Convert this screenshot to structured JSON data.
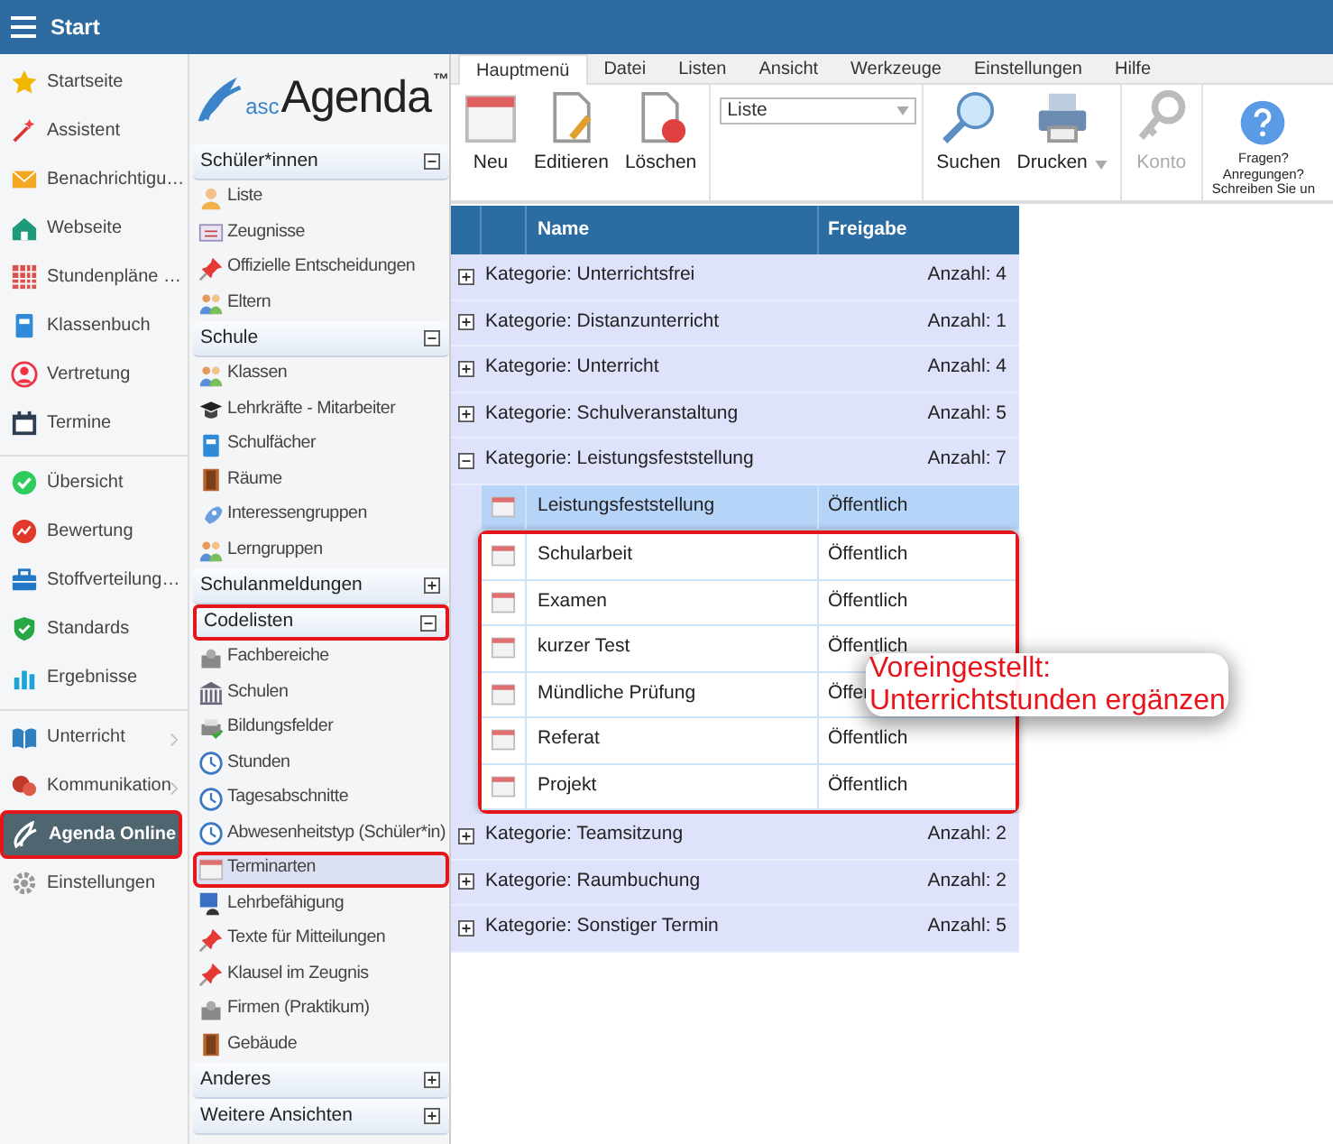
{
  "app_bar": {
    "title": "Start"
  },
  "sidebar": {
    "groups": [
      [
        {
          "label": "Startseite",
          "selected": false,
          "outlined": false,
          "submenu": false
        },
        {
          "label": "Assistent",
          "selected": false,
          "outlined": false,
          "submenu": false
        },
        {
          "label": "Benachrichtigu…",
          "selected": false,
          "outlined": false,
          "submenu": false
        },
        {
          "label": "Webseite",
          "selected": false,
          "outlined": false,
          "submenu": false
        },
        {
          "label": "Stundenpläne …",
          "selected": false,
          "outlined": false,
          "submenu": false
        },
        {
          "label": "Klassenbuch",
          "selected": false,
          "outlined": false,
          "submenu": false
        },
        {
          "label": "Vertretung",
          "selected": false,
          "outlined": false,
          "submenu": false
        },
        {
          "label": "Termine",
          "selected": false,
          "outlined": false,
          "submenu": false
        }
      ],
      [
        {
          "label": "Übersicht",
          "selected": false,
          "outlined": false,
          "submenu": false
        },
        {
          "label": "Bewertung",
          "selected": false,
          "outlined": false,
          "submenu": false
        },
        {
          "label": "Stoffverteilung…",
          "selected": false,
          "outlined": false,
          "submenu": false
        },
        {
          "label": "Standards",
          "selected": false,
          "outlined": false,
          "submenu": false
        },
        {
          "label": "Ergebnisse",
          "selected": false,
          "outlined": false,
          "submenu": false
        }
      ],
      [
        {
          "label": "Unterricht",
          "selected": false,
          "outlined": false,
          "submenu": true
        },
        {
          "label": "Kommunikation",
          "selected": false,
          "outlined": false,
          "submenu": true
        },
        {
          "label": "Agenda Online",
          "selected": true,
          "outlined": true,
          "submenu": false
        },
        {
          "label": "Einstellungen",
          "selected": false,
          "outlined": false,
          "submenu": false
        }
      ]
    ]
  },
  "module_panel": {
    "logo": {
      "prefix": "asc",
      "name": "Agenda",
      "mark": "™"
    },
    "sections": [
      {
        "title": "Schüler*innen",
        "expanded": true,
        "outlined": false,
        "items": [
          {
            "label": "Liste",
            "selected": false,
            "outlined": false
          },
          {
            "label": "Zeugnisse",
            "selected": false,
            "outlined": false
          },
          {
            "label": "Offizielle Entscheidungen",
            "selected": false,
            "outlined": false
          },
          {
            "label": "Eltern",
            "selected": false,
            "outlined": false
          }
        ]
      },
      {
        "title": "Schule",
        "expanded": true,
        "outlined": false,
        "items": [
          {
            "label": "Klassen",
            "selected": false,
            "outlined": false
          },
          {
            "label": "Lehrkräfte - Mitarbeiter",
            "selected": false,
            "outlined": false
          },
          {
            "label": "Schulfächer",
            "selected": false,
            "outlined": false
          },
          {
            "label": "Räume",
            "selected": false,
            "outlined": false
          },
          {
            "label": "Interessengruppen",
            "selected": false,
            "outlined": false
          },
          {
            "label": "Lerngruppen",
            "selected": false,
            "outlined": false
          }
        ]
      },
      {
        "title": "Schulanmeldungen",
        "expanded": false,
        "outlined": false
      },
      {
        "title": "Codelisten",
        "expanded": true,
        "outlined": true,
        "items": [
          {
            "label": "Fachbereiche",
            "selected": false,
            "outlined": false
          },
          {
            "label": "Schulen",
            "selected": false,
            "outlined": false
          },
          {
            "label": "Bildungsfelder",
            "selected": false,
            "outlined": false
          },
          {
            "label": "Stunden",
            "selected": false,
            "outlined": false
          },
          {
            "label": "Tagesabschnitte",
            "selected": false,
            "outlined": false
          },
          {
            "label": "Abwesenheitstyp (Schüler*in)",
            "selected": false,
            "outlined": false
          },
          {
            "label": "Terminarten",
            "selected": true,
            "outlined": true
          },
          {
            "label": "Lehrbefähigung",
            "selected": false,
            "outlined": false
          },
          {
            "label": "Texte für Mitteilungen",
            "selected": false,
            "outlined": false
          },
          {
            "label": "Klausel im Zeugnis",
            "selected": false,
            "outlined": false
          },
          {
            "label": "Firmen (Praktikum)",
            "selected": false,
            "outlined": false
          },
          {
            "label": "Gebäude",
            "selected": false,
            "outlined": false
          }
        ]
      },
      {
        "title": "Anderes",
        "expanded": false,
        "outlined": false
      },
      {
        "title": "Weitere Ansichten",
        "expanded": false,
        "outlined": false
      }
    ]
  },
  "ribbon": {
    "tabs": [
      {
        "label": "Hauptmenü",
        "selected": true
      },
      {
        "label": "Datei",
        "selected": false
      },
      {
        "label": "Listen",
        "selected": false
      },
      {
        "label": "Ansicht",
        "selected": false
      },
      {
        "label": "Werkzeuge",
        "selected": false
      },
      {
        "label": "Einstellungen",
        "selected": false
      },
      {
        "label": "Hilfe",
        "selected": false
      }
    ],
    "groups": [
      {
        "kind": "buttons",
        "buttons": [
          {
            "label": "Neu",
            "disabled": false,
            "dropdown": false
          },
          {
            "label": "Editieren",
            "disabled": false,
            "dropdown": false
          },
          {
            "label": "Löschen",
            "disabled": false,
            "dropdown": false
          }
        ]
      },
      {
        "kind": "select",
        "value": "Liste"
      },
      {
        "kind": "buttons",
        "buttons": [
          {
            "label": "Suchen",
            "disabled": false,
            "dropdown": false
          },
          {
            "label": "Drucken",
            "disabled": false,
            "dropdown": true
          }
        ]
      },
      {
        "kind": "buttons",
        "buttons": [
          {
            "label": "Konto",
            "disabled": true,
            "dropdown": false
          }
        ]
      },
      {
        "kind": "help",
        "lines": [
          "Fragen?",
          "Anregungen?",
          "Schreiben Sie un"
        ]
      }
    ]
  },
  "table": {
    "columns": [
      "Name",
      "Freigabe"
    ],
    "categories": [
      {
        "label": "Kategorie: Unterrichtsfrei",
        "count": "Anzahl: 4",
        "expanded": false
      },
      {
        "label": "Kategorie: Distanzunterricht",
        "count": "Anzahl: 1",
        "expanded": false
      },
      {
        "label": "Kategorie: Unterricht",
        "count": "Anzahl: 4",
        "expanded": false
      },
      {
        "label": "Kategorie: Schulveranstaltung",
        "count": "Anzahl: 5",
        "expanded": false
      },
      {
        "label": "Kategorie: Leistungsfeststellung",
        "count": "Anzahl: 7",
        "expanded": true,
        "rows": [
          {
            "name": "Leistungsfeststellung",
            "freigabe": "Öffentlich",
            "selected": true,
            "outlined": false
          },
          {
            "name": "Schularbeit",
            "freigabe": "Öffentlich",
            "selected": false,
            "outlined": true
          },
          {
            "name": "Examen",
            "freigabe": "Öffentlich",
            "selected": false,
            "outlined": true
          },
          {
            "name": "kurzer Test",
            "freigabe": "Öffentlich",
            "selected": false,
            "outlined": true
          },
          {
            "name": "Mündliche Prüfung",
            "freigabe": "Öffen",
            "selected": false,
            "outlined": true
          },
          {
            "name": "Referat",
            "freigabe": "Öffentlich",
            "selected": false,
            "outlined": true
          },
          {
            "name": "Projekt",
            "freigabe": "Öffentlich",
            "selected": false,
            "outlined": true
          }
        ]
      },
      {
        "label": "Kategorie: Teamsitzung",
        "count": "Anzahl: 2",
        "expanded": false
      },
      {
        "label": "Kategorie: Raumbuchung",
        "count": "Anzahl: 2",
        "expanded": false
      },
      {
        "label": "Kategorie: Sonstiger Termin",
        "count": "Anzahl: 5",
        "expanded": false
      }
    ]
  },
  "callout": {
    "text": "Voreingestellt:\nUnterrichtstunden ergänzen"
  }
}
